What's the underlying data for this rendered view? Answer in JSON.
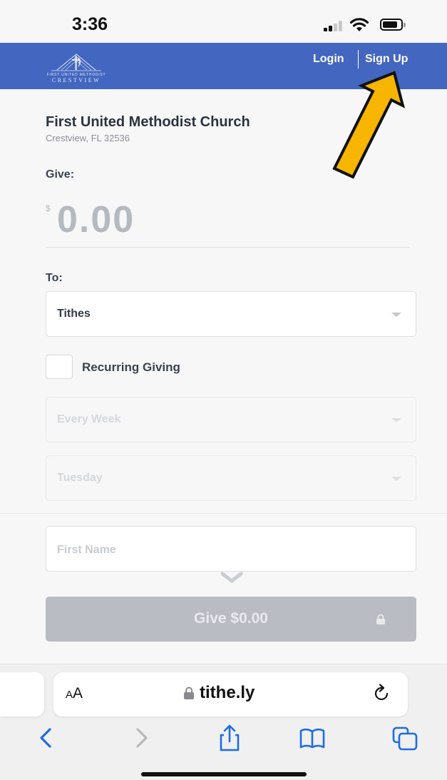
{
  "status_bar": {
    "time": "3:36",
    "icons": [
      "signal-icon",
      "wifi-icon",
      "battery-icon"
    ]
  },
  "header": {
    "logo_line1": "FIRST UNITED METHODIST",
    "logo_line2": "CRESTVIEW",
    "login_label": "Login",
    "signup_label": "Sign Up",
    "background": "#4366c0"
  },
  "organization": {
    "name": "First United Methodist Church",
    "location": "Crestview, FL 32536"
  },
  "give": {
    "label": "Give:",
    "currency_symbol": "$",
    "amount": "0.00"
  },
  "to": {
    "label": "To:",
    "selected": "Tithes"
  },
  "recurring": {
    "checkbox_label": "Recurring Giving",
    "checked": false,
    "frequency": "Every Week",
    "day": "Tuesday"
  },
  "form": {
    "first_name_placeholder": "First Name"
  },
  "submit": {
    "label": "Give $0.00"
  },
  "browser": {
    "text_size_label_big": "A",
    "text_size_label_small": "A",
    "url": "tithe.ly",
    "toolbar_icons": [
      "back-icon",
      "forward-icon",
      "share-icon",
      "bookmarks-icon",
      "tabs-icon"
    ]
  },
  "annotation": {
    "arrow_color": "#f7b500"
  }
}
